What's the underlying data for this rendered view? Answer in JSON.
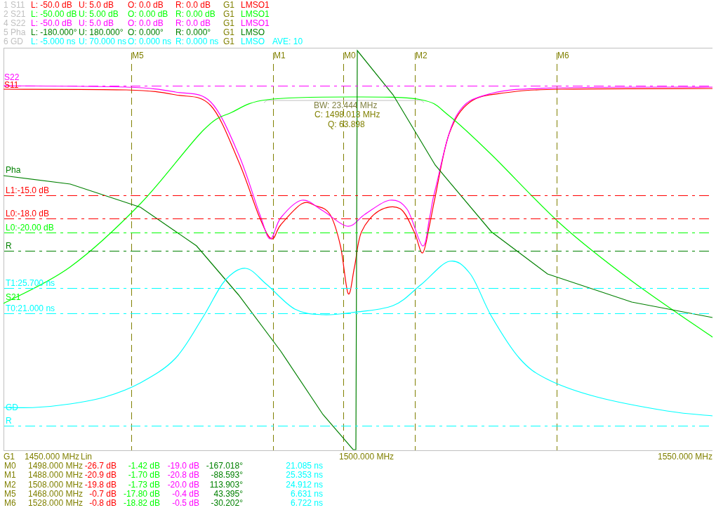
{
  "header": [
    {
      "trace": "1 S11",
      "color": "#ff0000",
      "l": "L: -50.0 dB",
      "u": "U: 5.0 dB",
      "o": "O: 0.0 dB",
      "r": "R: 0.0 dB",
      "group": "G1",
      "mode": "LMSO1"
    },
    {
      "trace": "2 S21",
      "color": "#00ff00",
      "l": "L: -50.00 dB",
      "u": "U: 5.00 dB",
      "o": "O: 0.00 dB",
      "r": "R: 0.00 dB",
      "group": "G1",
      "mode": "LMSO1"
    },
    {
      "trace": "4 S22",
      "color": "#ff00ff",
      "l": "L: -50.0 dB",
      "u": "U: 5.0 dB",
      "o": "O: 0.0 dB",
      "r": "R: 0.0 dB",
      "group": "G1",
      "mode": "LMSO1"
    },
    {
      "trace": "5 Pha",
      "color": "#008000",
      "l": "L: -180.000°",
      "u": "U: 180.000°",
      "o": "O: 0.000°",
      "r": "R: 0.000°",
      "group": "G1",
      "mode": "LMSO"
    },
    {
      "trace": "6 GD",
      "color": "#00ffff",
      "l": "L: -5.000 ns",
      "u": "U: 70.000 ns",
      "o": "O: 0.000 ns",
      "r": "R: 0.000 ns",
      "group": "G1",
      "mode": "LMSO",
      "average": "AVE: 10"
    }
  ],
  "plot": {
    "markers": [
      {
        "label": "M5"
      },
      {
        "label": "M1"
      },
      {
        "label": "M0"
      },
      {
        "label": "M2"
      },
      {
        "label": "M6"
      }
    ],
    "trace_labels": [
      {
        "label": "S22",
        "color": "#ff00ff"
      },
      {
        "label": "S11",
        "color": "#ff0000"
      },
      {
        "label": "Pha",
        "color": "#008000"
      },
      {
        "label": "S21",
        "color": "#00ff00"
      },
      {
        "label": "GD",
        "color": "#00ffff"
      }
    ],
    "ref_lines": [
      {
        "color": "#ff00ff"
      },
      {
        "label": "L1:-15.0 dB",
        "color": "#ff0000"
      },
      {
        "label": "L0:-18.0 dB",
        "color": "#ff0000"
      },
      {
        "label": "L0:-20.00 dB",
        "color": "#00ff00"
      },
      {
        "label": "R",
        "color": "#008000"
      },
      {
        "label": "T1:25.700 ns",
        "color": "#00ffff"
      },
      {
        "label": "T0:21.000 ns",
        "color": "#00ffff"
      },
      {
        "label": "R",
        "color": "#00ffff"
      }
    ],
    "annotation": {
      "bw": "BW: 23.444 MHz",
      "center": "C: 1498.013 MHz",
      "q": "Q: 63.898"
    }
  },
  "axis": {
    "group": "G1",
    "start": "1450.000 MHz",
    "scale": "Lin",
    "center": "1500.000 MHz",
    "stop": "1550.000 MHz"
  },
  "marker_table": [
    {
      "name": "M0",
      "freq": "1498.000 MHz",
      "values": [
        {
          "text": "-26.7 dB",
          "color": "#ff0000"
        },
        {
          "text": "-1.42 dB",
          "color": "#00ff00"
        },
        {
          "text": "-19.0 dB",
          "color": "#ff00ff"
        },
        {
          "text": "-167.018°",
          "color": "#008000"
        },
        {
          "text": "21.085 ns",
          "color": "#00ffff"
        }
      ]
    },
    {
      "name": "M1",
      "freq": "1488.000 MHz",
      "values": [
        {
          "text": "-20.9 dB",
          "color": "#ff0000"
        },
        {
          "text": "-1.70 dB",
          "color": "#00ff00"
        },
        {
          "text": "-20.8 dB",
          "color": "#ff00ff"
        },
        {
          "text": "-88.593°",
          "color": "#008000"
        },
        {
          "text": "25.353 ns",
          "color": "#00ffff"
        }
      ]
    },
    {
      "name": "M2",
      "freq": "1508.000 MHz",
      "values": [
        {
          "text": "-19.8 dB",
          "color": "#ff0000"
        },
        {
          "text": "-1.73 dB",
          "color": "#00ff00"
        },
        {
          "text": "-20.0 dB",
          "color": "#ff00ff"
        },
        {
          "text": "113.903°",
          "color": "#008000"
        },
        {
          "text": "24.912 ns",
          "color": "#00ffff"
        }
      ]
    },
    {
      "name": "M5",
      "freq": "1468.000 MHz",
      "values": [
        {
          "text": "-0.7 dB",
          "color": "#ff0000"
        },
        {
          "text": "-17.80 dB",
          "color": "#00ff00"
        },
        {
          "text": "-0.4 dB",
          "color": "#ff00ff"
        },
        {
          "text": "43.395°",
          "color": "#008000"
        },
        {
          "text": "6.631 ns",
          "color": "#00ffff"
        }
      ]
    },
    {
      "name": "M6",
      "freq": "1528.000 MHz",
      "values": [
        {
          "text": "-0.8 dB",
          "color": "#ff0000"
        },
        {
          "text": "-18.82 dB",
          "color": "#00ff00"
        },
        {
          "text": "-0.5 dB",
          "color": "#ff00ff"
        },
        {
          "text": "-30.202°",
          "color": "#008000"
        },
        {
          "text": "6.722 ns",
          "color": "#00ffff"
        }
      ]
    }
  ]
}
